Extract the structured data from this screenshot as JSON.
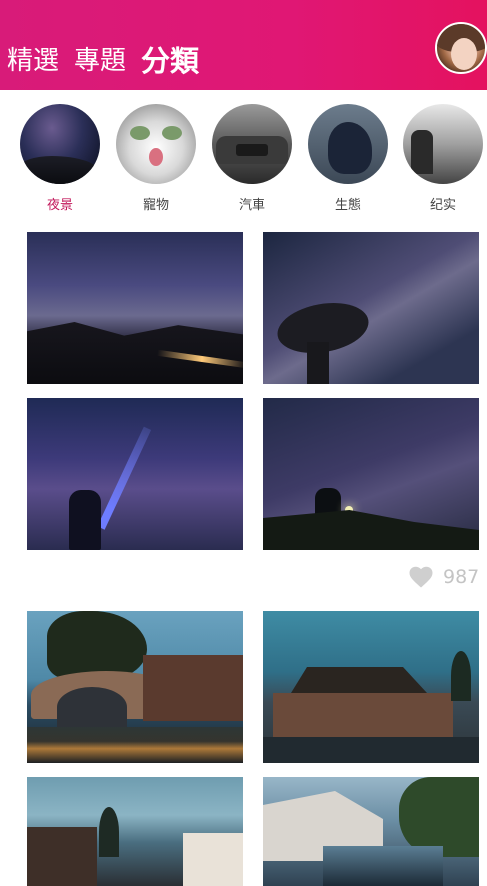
{
  "header": {
    "tabs": [
      {
        "label": "精選"
      },
      {
        "label": "專題"
      },
      {
        "label": "分類",
        "active": true
      }
    ],
    "avatar_icon": "user-avatar"
  },
  "categories": [
    {
      "label": "夜景",
      "active": true
    },
    {
      "label": "寵物"
    },
    {
      "label": "汽車"
    },
    {
      "label": "生態"
    },
    {
      "label": "纪实"
    }
  ],
  "post1": {
    "likes": "987",
    "like_icon": "heart-icon"
  },
  "colors": {
    "header_gradient_start": "#d81b79",
    "header_gradient_end": "#e4125f",
    "active_category": "#c2185b",
    "like_gray": "#c4c4c4"
  }
}
